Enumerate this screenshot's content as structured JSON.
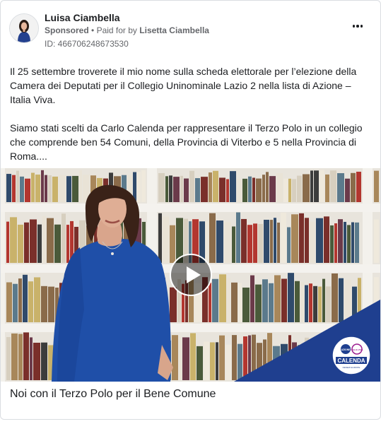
{
  "ad": {
    "page_name": "Luisa Ciambella",
    "sponsored_label": "Sponsored",
    "separator": "•",
    "paid_for_prefix": "Paid for by",
    "payer": "Lisetta Ciambella",
    "id_label": "ID: 466706248673530",
    "more_icon": "more-horizontal-icon"
  },
  "body": {
    "paragraph1": "Il 25 settembre troverete il mio nome sulla scheda elettorale per l’elezione della Camera dei Deputati per il Collegio Uninominale Lazio 2 nella lista di Azione – Italia Viva.",
    "paragraph2": "Siamo stati scelti da Carlo Calenda per rappresentare il Terzo Polo in un collegio che comprende ben 54 Comuni, della Provincia di Viterbo e 5 nella Provincia di Roma...."
  },
  "video": {
    "play_icon": "play-icon",
    "logo_text_main": "CALENDA",
    "logo_text_left": "AZIONE",
    "logo_text_right": "ITALIA VIVA",
    "logo_text_sub": "RENEW EUROPE"
  },
  "caption": {
    "title": "Noi con il Terzo Polo per il Bene Comune"
  },
  "colors": {
    "brand_blue": "#1f3f8f",
    "text_primary": "#1c1e21",
    "text_secondary": "#65676b"
  }
}
